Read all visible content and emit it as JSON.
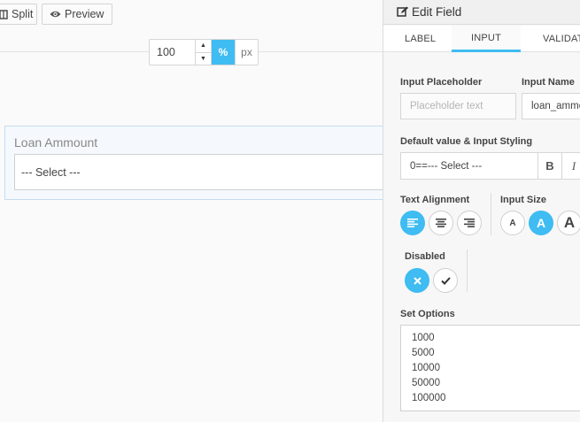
{
  "toolbar": {
    "split_label": "Split",
    "preview_label": "Preview"
  },
  "width_control": {
    "value": "100",
    "unit_percent": "%",
    "unit_px": "px",
    "selected_unit": "%"
  },
  "field": {
    "label": "Loan Ammount",
    "select_value": "--- Select ---"
  },
  "panel": {
    "title": "Edit Field",
    "tabs": [
      "LABEL",
      "INPUT",
      "VALIDAT"
    ],
    "active_tab": "INPUT",
    "placeholder_label": "Input Placeholder",
    "placeholder_hint": "Placeholder text",
    "name_label": "Input Name",
    "name_value": "loan_ammo",
    "default_label": "Default value & Input Styling",
    "default_value": "0==--- Select ---",
    "bold_glyph": "B",
    "italic_glyph": "I",
    "alignment_label": "Text Alignment",
    "size_label": "Input Size",
    "size_glyphs": [
      "A",
      "A",
      "A"
    ],
    "disabled_label": "Disabled",
    "options_label": "Set Options",
    "options": [
      "1000",
      "5000",
      "10000",
      "50000",
      "100000"
    ]
  },
  "colors": {
    "accent": "#3fbcf2",
    "field_border": "#c5dcf0"
  }
}
